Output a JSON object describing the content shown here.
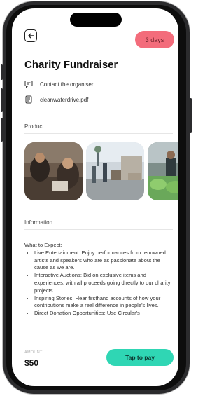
{
  "status_badge": "3 days",
  "title": "Charity Fundraiser",
  "contact_label": "Contact the organiser",
  "attachment_label": "cleanwaterdrive.pdf",
  "product_section": "Product",
  "information_section": "Information",
  "info": {
    "heading": "What to Expect:",
    "items": [
      "Live Entertainment: Enjoy performances from renowned artists and speakers who are as passionate about the cause as we are.",
      "Interactive Auctions: Bid on exclusive items and experiences, with all proceeds going directly to our charity projects.",
      "Inspiring Stories: Hear firsthand accounts of how your contributions make a real difference in people's lives.",
      "Direct Donation Opportunities: Use Circular's"
    ]
  },
  "footer": {
    "amount_label": "AMOUNT",
    "amount": "$50",
    "pay_label": "Tap to pay"
  },
  "colors": {
    "badge": "#f36c7b",
    "pay_button": "#2fd6b4"
  },
  "icons": [
    "back-arrow-icon",
    "chat-bubble-icon",
    "document-icon"
  ]
}
